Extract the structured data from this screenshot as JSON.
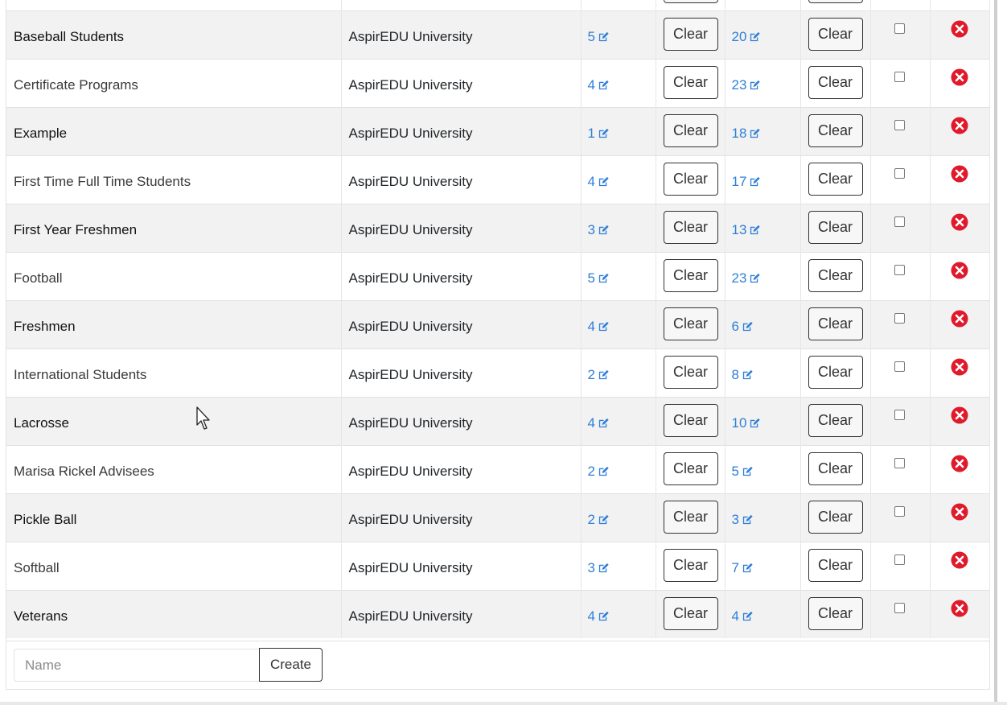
{
  "table": {
    "clear_label": "Clear",
    "rows": [
      {
        "name": "Baseball Students",
        "org": "AspirEDU University",
        "count1": "5",
        "count2": "20"
      },
      {
        "name": "Certificate Programs",
        "org": "AspirEDU University",
        "count1": "4",
        "count2": "23"
      },
      {
        "name": "Example",
        "org": "AspirEDU University",
        "count1": "1",
        "count2": "18"
      },
      {
        "name": "First Time Full Time Students",
        "org": "AspirEDU University",
        "count1": "4",
        "count2": "17"
      },
      {
        "name": "First Year Freshmen",
        "org": "AspirEDU University",
        "count1": "3",
        "count2": "13"
      },
      {
        "name": "Football",
        "org": "AspirEDU University",
        "count1": "5",
        "count2": "23"
      },
      {
        "name": "Freshmen",
        "org": "AspirEDU University",
        "count1": "4",
        "count2": "6"
      },
      {
        "name": "International Students",
        "org": "AspirEDU University",
        "count1": "2",
        "count2": "8"
      },
      {
        "name": "Lacrosse",
        "org": "AspirEDU University",
        "count1": "4",
        "count2": "10"
      },
      {
        "name": "Marisa Rickel Advisees",
        "org": "AspirEDU University",
        "count1": "2",
        "count2": "5"
      },
      {
        "name": "Pickle Ball",
        "org": "AspirEDU University",
        "count1": "2",
        "count2": "3"
      },
      {
        "name": "Softball",
        "org": "AspirEDU University",
        "count1": "3",
        "count2": "7"
      },
      {
        "name": "Veterans",
        "org": "AspirEDU University",
        "count1": "4",
        "count2": "4"
      }
    ]
  },
  "create_form": {
    "name_placeholder": "Name",
    "create_label": "Create"
  },
  "colors": {
    "link": "#2f7fd6",
    "delete": "#e0192b",
    "stripe": "#f2f2f2"
  },
  "icons": {
    "edit": "edit-icon",
    "delete": "delete-circle-icon",
    "cursor": "mouse-pointer-icon"
  }
}
